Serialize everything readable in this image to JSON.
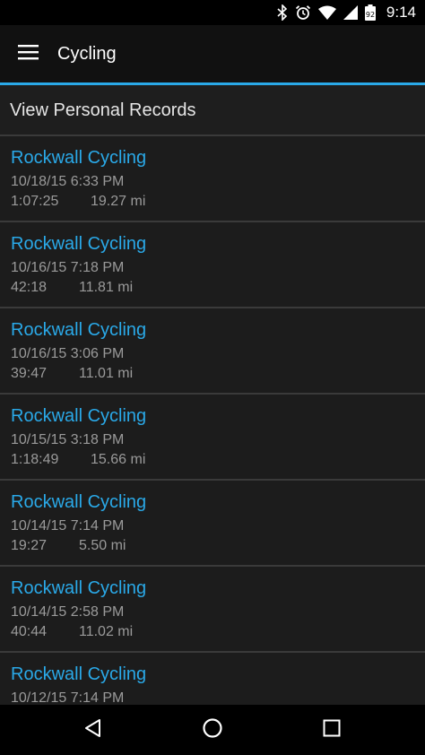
{
  "status_bar": {
    "time": "9:14",
    "icons": [
      "bluetooth-icon",
      "alarm-icon",
      "wifi-icon",
      "cell-signal-icon",
      "battery-icon"
    ]
  },
  "app_bar": {
    "title": "Cycling",
    "menu_icon": "hamburger-menu-icon"
  },
  "records": {
    "label": "View Personal Records"
  },
  "activities": [
    {
      "name": "Rockwall Cycling",
      "date": "10/18/15 6:33 PM",
      "duration": "1:07:25",
      "distance": "19.27 mi"
    },
    {
      "name": "Rockwall Cycling",
      "date": "10/16/15 7:18 PM",
      "duration": "42:18",
      "distance": "11.81 mi"
    },
    {
      "name": "Rockwall Cycling",
      "date": "10/16/15 3:06 PM",
      "duration": "39:47",
      "distance": "11.01 mi"
    },
    {
      "name": "Rockwall Cycling",
      "date": "10/15/15 3:18 PM",
      "duration": "1:18:49",
      "distance": "15.66 mi"
    },
    {
      "name": "Rockwall Cycling",
      "date": "10/14/15 7:14 PM",
      "duration": "19:27",
      "distance": "5.50 mi"
    },
    {
      "name": "Rockwall Cycling",
      "date": "10/14/15 2:58 PM",
      "duration": "40:44",
      "distance": "11.02 mi"
    },
    {
      "name": "Rockwall Cycling",
      "date": "10/12/15 7:14 PM",
      "duration": "",
      "distance": ""
    }
  ],
  "nav_bar": {
    "icons": [
      "back-icon",
      "home-icon",
      "recents-icon"
    ]
  },
  "colors": {
    "accent": "#2aa9e8",
    "background": "#1c1c1c",
    "secondary_text": "#9a9a9a"
  }
}
